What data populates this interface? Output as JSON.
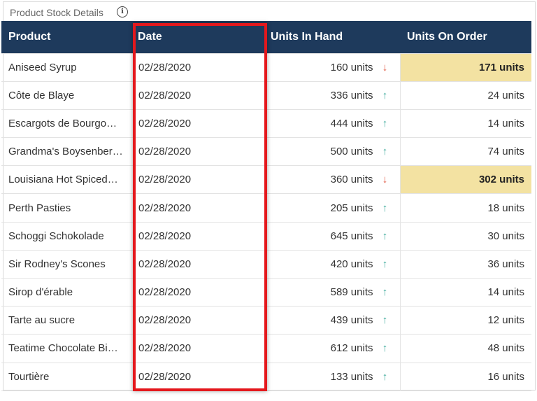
{
  "panel": {
    "title": "Product Stock Details",
    "info_icon": "info-icon"
  },
  "columns": [
    "Product",
    "Date",
    "Units In Hand",
    "Units On Order"
  ],
  "colors": {
    "header_bg": "#1e3a5c",
    "highlight_cell": "#f3e2a2",
    "arrow_up": "#3aa99a",
    "arrow_down": "#e0553f",
    "selection_border": "#e4181d"
  },
  "rows": [
    {
      "product": "Aniseed Syrup",
      "date": "02/28/2020",
      "in_hand": "160 units",
      "trend": "down",
      "on_order": "171 units",
      "highlight": true
    },
    {
      "product": "Côte de Blaye",
      "date": "02/28/2020",
      "in_hand": "336 units",
      "trend": "up",
      "on_order": "24 units",
      "highlight": false
    },
    {
      "product": "Escargots de Bourgo…",
      "date": "02/28/2020",
      "in_hand": "444 units",
      "trend": "up",
      "on_order": "14 units",
      "highlight": false
    },
    {
      "product": "Grandma's Boysenber…",
      "date": "02/28/2020",
      "in_hand": "500 units",
      "trend": "up",
      "on_order": "74 units",
      "highlight": false
    },
    {
      "product": "Louisiana Hot Spiced…",
      "date": "02/28/2020",
      "in_hand": "360 units",
      "trend": "down",
      "on_order": "302 units",
      "highlight": true
    },
    {
      "product": "Perth Pasties",
      "date": "02/28/2020",
      "in_hand": "205 units",
      "trend": "up",
      "on_order": "18 units",
      "highlight": false
    },
    {
      "product": "Schoggi Schokolade",
      "date": "02/28/2020",
      "in_hand": "645 units",
      "trend": "up",
      "on_order": "30 units",
      "highlight": false
    },
    {
      "product": "Sir Rodney's Scones",
      "date": "02/28/2020",
      "in_hand": "420 units",
      "trend": "up",
      "on_order": "36 units",
      "highlight": false
    },
    {
      "product": "Sirop d'érable",
      "date": "02/28/2020",
      "in_hand": "589 units",
      "trend": "up",
      "on_order": "14 units",
      "highlight": false
    },
    {
      "product": "Tarte au sucre",
      "date": "02/28/2020",
      "in_hand": "439 units",
      "trend": "up",
      "on_order": "12 units",
      "highlight": false
    },
    {
      "product": "Teatime Chocolate Bi…",
      "date": "02/28/2020",
      "in_hand": "612 units",
      "trend": "up",
      "on_order": "48 units",
      "highlight": false
    },
    {
      "product": "Tourtière",
      "date": "02/28/2020",
      "in_hand": "133 units",
      "trend": "up",
      "on_order": "16 units",
      "highlight": false
    }
  ]
}
